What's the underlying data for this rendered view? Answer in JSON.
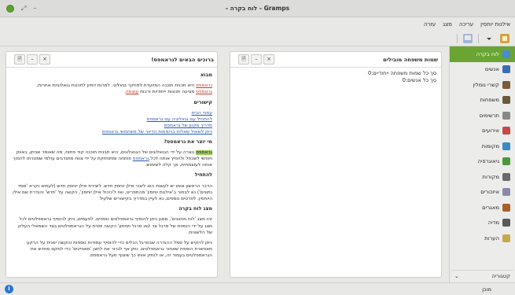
{
  "window": {
    "title": "Gramps - לוח בקרה -"
  },
  "menubar": {
    "items": [
      "אילנות יוחסין",
      "עריכה",
      "מצג",
      "עזרה"
    ]
  },
  "sidebar": {
    "items": [
      {
        "label": "לוח בקרה",
        "icon": "dashboard-icon",
        "color": "#4a8bd0"
      },
      {
        "label": "אנשים",
        "icon": "person-icon",
        "color": "#3a6cb5"
      },
      {
        "label": "קשרי גומלין",
        "icon": "relationship-icon",
        "color": "#7a5b3a"
      },
      {
        "label": "משפחות",
        "icon": "family-icon",
        "color": "#6a5a3a"
      },
      {
        "label": "תרשימים",
        "icon": "chart-icon",
        "color": "#888888"
      },
      {
        "label": "אירועים",
        "icon": "event-icon",
        "color": "#c44a4a"
      },
      {
        "label": "מקומות",
        "icon": "place-icon",
        "color": "#3a8ac4"
      },
      {
        "label": "גיאוגרפיה",
        "icon": "geography-icon",
        "color": "#4a9a3a"
      },
      {
        "label": "מקורות",
        "icon": "source-icon",
        "color": "#6a6a6a"
      },
      {
        "label": "איזכורים",
        "icon": "citation-icon",
        "color": "#8a8aa8"
      },
      {
        "label": "מאגרים",
        "icon": "repository-icon",
        "color": "#a8602a"
      },
      {
        "label": "מדיה",
        "icon": "media-icon",
        "color": "#5a5a5a"
      },
      {
        "label": "הערות",
        "icon": "note-icon",
        "color": "#c8a848"
      }
    ],
    "category_label": "קטגוריה"
  },
  "gramplets": {
    "stats": {
      "title": "שמות משפחה מובילים",
      "lines": [
        "סך כל שמות משפחה ייחודיים:0",
        "סך כל אנשים:0"
      ]
    },
    "welcome": {
      "title": "ברוכים הבאים לגראמפס!",
      "intro_heading": "מבוא",
      "intro_link": "גראמפס",
      "intro_text": " היא תכנית תוכנה המיועדת למחקר גנאלוגי. למרות דמיון לתכנות גנאלוגיות אחרות,",
      "intro_link2": "גראמפס",
      "intro_text2": " מציעה תכונות ייחודיות ורבות ",
      "intro_link3": "עוצמה",
      "links_heading": "קישורים",
      "links": [
        "עמוד הבית",
        "להתחיל עם גנאלוגיה עם גראמפס",
        "מדריך מקוון של גראמפס",
        "ניתן לשאול שאלות ברשימות הדיוור של משתמשי גראמפס"
      ],
      "who_heading": "מי יוצר את גראמפס?",
      "who_hl": "גראמפס",
      "who_text": " נוצרה על ידי הגנאלוגים של הגנאלוגים, היא תבנית תוכנה קוד פתוח, מה שאומר שניתן, באופן חופשי לשכפל ולהפיץ אותה לכל.",
      "who_link": "גראמפס",
      "who_text2": " פותחה ומתוחזקת על ידי צוות מתנדבים עולמי שמטרתו להפוך אותה לעוצמתית, אך קלה לשימוש.",
      "start_heading": "להתחיל",
      "start_text": "הדבר הראשון אותו יש לעשות הוא ליצור אילן יוחסין חדש. ליצירת אילן יוחסין חדש (לעתים נקרא 'מסד נתונים') נא לבחור ב'אילנות יוחסין' מהתפריט, ואז ל'ניהול אילן יוחסין', הקשה על 'חדש' והגדרת שם אילן היוחסין. לפרטים נוספים, נא לעיין במדריך בקישורים שלעיל",
      "dash_heading": "מצג לוח בקרה",
      "dash_text": "זהו מצג 'לוח מחוונים', מסגן ניתן להוסיף גראמפלטים נוספים. לפעמים, ניתן להוסיף גראמפלטים לכל מצג על ידי הוספת של סרגל צד ו/או סרגל תחתון' הקשה ימנית על הגראמפלטים בצד השמאלי העליון של הלשונית.",
      "dash_text2": "ניתן להקיש על סמל ההגדרה שבסרגל הכלים כדי להוסיף עמודות נוספות והקשה ימנית על הרקע מאפשרת הוספת שאחור גראמפלטים. ניתן אף לגרור את לחצן 'מאפיינים' כדי למקם מחדש את הגראמפלטים בעמוד זה, או לנתק אותו כך שיצוף מעל גראמפס."
    }
  },
  "statusbar": {
    "text": "מוכן"
  },
  "colors": {
    "accent": "#6aa533",
    "link": "#2859a8"
  }
}
